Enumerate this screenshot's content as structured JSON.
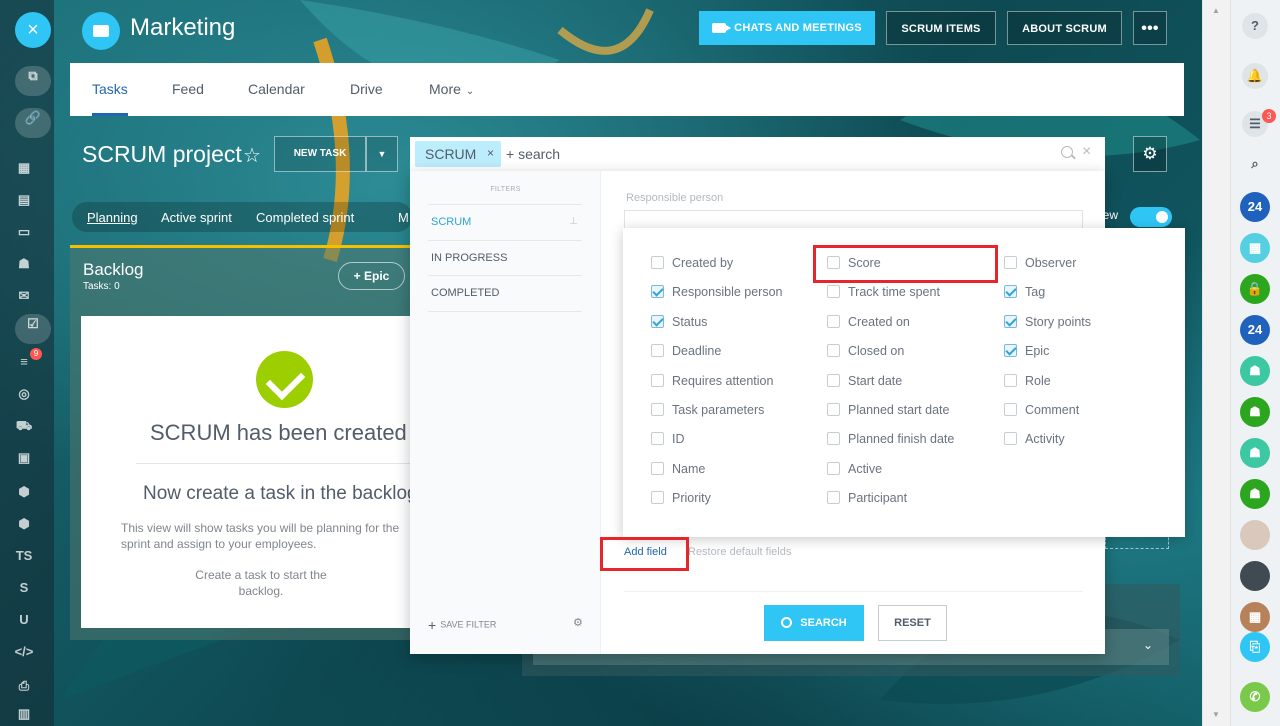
{
  "header": {
    "title": "Marketing",
    "chats_label": "CHATS AND MEETINGS",
    "scrum_items_label": "SCRUM ITEMS",
    "about_scrum_label": "ABOUT SCRUM",
    "more_label": "•••"
  },
  "tabs": [
    "Tasks",
    "Feed",
    "Calendar",
    "Drive",
    "More"
  ],
  "project": {
    "title": "SCRUM project",
    "new_task_label": "NEW TASK",
    "view_label": "iew"
  },
  "subnav": [
    "Planning",
    "Active sprint",
    "Completed sprint",
    "M"
  ],
  "backlog": {
    "title": "Backlog",
    "count": "Tasks: 0",
    "epic_label": "+ Epic",
    "heading": "SCRUM has been created",
    "subheading": "Now create a task in the backlog",
    "description": "This view will show tasks you will be planning for the sprint and assign to your employees.",
    "hint": "Create a task to start the backlog."
  },
  "search": {
    "chip": "SCRUM",
    "chip_remove": "×",
    "placeholder": "+ search",
    "clear": "×"
  },
  "filters": {
    "label": "FILTERS",
    "items": [
      "SCRUM",
      "IN PROGRESS",
      "COMPLETED"
    ],
    "save_filter": "SAVE FILTER",
    "responsible_label": "Responsible person",
    "add_field": "Add field",
    "restore": "Restore default fields",
    "search_button": "SEARCH",
    "reset_button": "RESET"
  },
  "fields": {
    "col1": [
      {
        "label": "Created by",
        "checked": false
      },
      {
        "label": "Responsible person",
        "checked": true
      },
      {
        "label": "Status",
        "checked": true
      },
      {
        "label": "Deadline",
        "checked": false
      },
      {
        "label": "Requires attention",
        "checked": false
      },
      {
        "label": "Task parameters",
        "checked": false
      },
      {
        "label": "ID",
        "checked": false
      },
      {
        "label": "Name",
        "checked": false
      },
      {
        "label": "Priority",
        "checked": false
      }
    ],
    "col2": [
      {
        "label": "Score",
        "checked": false
      },
      {
        "label": "Track time spent",
        "checked": false
      },
      {
        "label": "Created on",
        "checked": false
      },
      {
        "label": "Closed on",
        "checked": false
      },
      {
        "label": "Start date",
        "checked": false
      },
      {
        "label": "Planned start date",
        "checked": false
      },
      {
        "label": "Planned finish date",
        "checked": false
      },
      {
        "label": "Active",
        "checked": false
      },
      {
        "label": "Participant",
        "checked": false
      }
    ],
    "col3": [
      {
        "label": "Observer",
        "checked": false
      },
      {
        "label": "Tag",
        "checked": true
      },
      {
        "label": "Story points",
        "checked": true
      },
      {
        "label": "Epic",
        "checked": true
      },
      {
        "label": "Role",
        "checked": false
      },
      {
        "label": "Comment",
        "checked": false
      },
      {
        "label": "Activity",
        "checked": false
      }
    ]
  },
  "left_rail": {
    "close": "×",
    "ts": "TS",
    "s": "S",
    "u": "U",
    "code": "</>",
    "badge": "9"
  },
  "right_rail": {
    "help": "?",
    "badge": "3",
    "b24": "24"
  },
  "colors": {
    "accent": "#2fc6f6",
    "brand_blue": "#2067b0",
    "success": "#9dcf00",
    "highlight": "#e5262b"
  }
}
